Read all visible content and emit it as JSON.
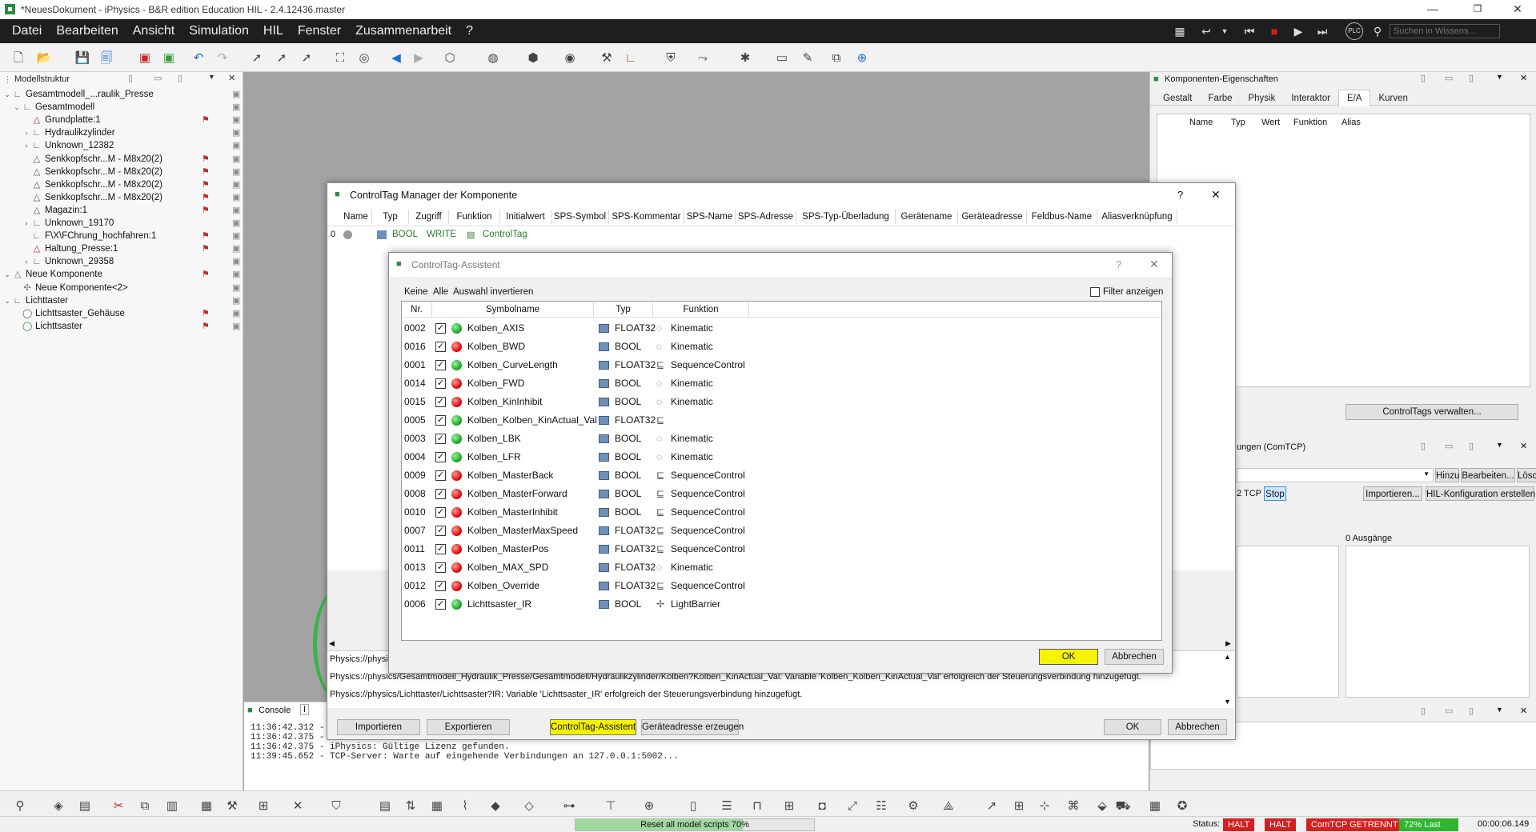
{
  "window": {
    "title": "*NeuesDokument - iPhysics - B&R edition Education HIL - 2.4.12436.master"
  },
  "menu": [
    "Datei",
    "Bearbeiten",
    "Ansicht",
    "Simulation",
    "HIL",
    "Fenster",
    "Zusammenarbeit",
    "?"
  ],
  "search": {
    "placeholder": "Suchen in Wissens..."
  },
  "plc_label": "PLC",
  "left_panel": {
    "title": "Modellstruktur",
    "tree": [
      {
        "label": "Gesamtmodell_...raulik_Presse",
        "level": 0
      },
      {
        "label": "Gesamtmodell",
        "level": 1
      },
      {
        "label": "Grundplatte:1",
        "level": 2
      },
      {
        "label": "Hydraulikzylinder",
        "level": 2
      },
      {
        "label": "Unknown_12382",
        "level": 2
      },
      {
        "label": "Senkkopfschr...M - M8x20(2)",
        "level": 2
      },
      {
        "label": "Senkkopfschr...M - M8x20(2)",
        "level": 2
      },
      {
        "label": "Senkkopfschr...M - M8x20(2)",
        "level": 2
      },
      {
        "label": "Senkkopfschr...M - M8x20(2)",
        "level": 2
      },
      {
        "label": "Magazin:1",
        "level": 2
      },
      {
        "label": "Unknown_19170",
        "level": 2
      },
      {
        "label": "F\\X\\FChrung_hochfahren:1",
        "level": 2
      },
      {
        "label": "Haltung_Presse:1",
        "level": 2
      },
      {
        "label": "Unknown_29358",
        "level": 2
      },
      {
        "label": "Neue Komponente",
        "level": 0
      },
      {
        "label": "Neue Komponente<2>",
        "level": 1
      },
      {
        "label": "Lichttaster",
        "level": 0
      },
      {
        "label": "Lichttsaster_Gehäuse",
        "level": 1
      },
      {
        "label": "Lichttsaster",
        "level": 1
      }
    ]
  },
  "right_panel": {
    "title": "Komponenten-Eigenschaften",
    "tabs": [
      "Gestalt",
      "Farbe",
      "Physik",
      "Interaktor",
      "E/A",
      "Kurven"
    ],
    "columns": [
      "Name",
      "Typ",
      "Wert",
      "Funktion",
      "Alias"
    ],
    "manage_button": "ControlTags verwalten...",
    "conn_title": "ungen (ComTCP)",
    "btn_add": "Hinzu",
    "btn_edit": "Bearbeiten...",
    "btn_del": "Löschen",
    "tcp_label": "2 TCP",
    "btn_stop": "Stop",
    "btn_import": "Importieren...",
    "btn_hil": "HIL-Konfiguration erstellen",
    "outputs_label": "0 Ausgänge"
  },
  "manager": {
    "title": "ControlTag Manager der Komponente",
    "help": "?",
    "close": "✕",
    "columns": [
      "Name",
      "Typ",
      "Zugriff",
      "Funktion",
      "Initialwert",
      "SPS-Symbol",
      "SPS-Kommentar",
      "SPS-Name",
      "SPS-Adresse",
      "SPS-Typ-Überladung",
      "Gerätename",
      "Geräteadresse",
      "Feldbus-Name",
      "Aliasverknüpfung"
    ],
    "row": {
      "index": "0",
      "type": "BOOL",
      "access": "WRITE",
      "function": "ControlTag"
    },
    "log": [
      "Physics://physi",
      "Physics://physics/Gesamtmodell_Hydraulik_Presse/Gesamtmodell/Hydraulikzylinder/Kolben?Kolben_KinActual_Val: Variable 'Kolben_Kolben_KinActual_Val' erfolgreich der Steuerungsverbindung hinzugefügt.",
      "Physics://physics/Lichttaster/Lichttsaster?IR: Variable 'Lichttsaster_IR' erfolgreich der Steuerungsverbindung hinzugefügt."
    ],
    "buttons": {
      "import": "Importieren",
      "export": "Exportieren",
      "assistant": "ControlTag-Assistent",
      "address": "Geräteadresse erzeugen",
      "ok": "OK",
      "cancel": "Abbrechen"
    }
  },
  "assistant": {
    "title": "ControlTag-Assistent",
    "help": "?",
    "close": "✕",
    "links": [
      "Keine",
      "Alle",
      "Auswahl invertieren"
    ],
    "filter_label": "Filter anzeigen",
    "columns": [
      "Nr.",
      "Symbolname",
      "Typ",
      "Funktion"
    ],
    "rows": [
      {
        "nr": "0002",
        "name": "Kolben_AXIS",
        "type": "FLOAT32",
        "func": "Kinematic",
        "status": "green"
      },
      {
        "nr": "0016",
        "name": "Kolben_BWD",
        "type": "BOOL",
        "func": "Kinematic",
        "status": "red"
      },
      {
        "nr": "0001",
        "name": "Kolben_CurveLength",
        "type": "FLOAT32",
        "func": "SequenceControl",
        "status": "green"
      },
      {
        "nr": "0014",
        "name": "Kolben_FWD",
        "type": "BOOL",
        "func": "Kinematic",
        "status": "red"
      },
      {
        "nr": "0015",
        "name": "Kolben_KinInhibit",
        "type": "BOOL",
        "func": "Kinematic",
        "status": "red"
      },
      {
        "nr": "0005",
        "name": "Kolben_Kolben_KinActual_Val",
        "type": "FLOAT32",
        "func": "",
        "status": "green"
      },
      {
        "nr": "0003",
        "name": "Kolben_LBK",
        "type": "BOOL",
        "func": "Kinematic",
        "status": "green"
      },
      {
        "nr": "0004",
        "name": "Kolben_LFR",
        "type": "BOOL",
        "func": "Kinematic",
        "status": "green"
      },
      {
        "nr": "0009",
        "name": "Kolben_MasterBack",
        "type": "BOOL",
        "func": "SequenceControl",
        "status": "red"
      },
      {
        "nr": "0008",
        "name": "Kolben_MasterForward",
        "type": "BOOL",
        "func": "SequenceControl",
        "status": "red"
      },
      {
        "nr": "0010",
        "name": "Kolben_MasterInhibit",
        "type": "BOOL",
        "func": "SequenceControl",
        "status": "red"
      },
      {
        "nr": "0007",
        "name": "Kolben_MasterMaxSpeed",
        "type": "FLOAT32",
        "func": "SequenceControl",
        "status": "red"
      },
      {
        "nr": "0011",
        "name": "Kolben_MasterPos",
        "type": "FLOAT32",
        "func": "SequenceControl",
        "status": "red"
      },
      {
        "nr": "0013",
        "name": "Kolben_MAX_SPD",
        "type": "FLOAT32",
        "func": "Kinematic",
        "status": "red"
      },
      {
        "nr": "0012",
        "name": "Kolben_Override",
        "type": "FLOAT32",
        "func": "SequenceControl",
        "status": "red"
      },
      {
        "nr": "0006",
        "name": "Lichttsaster_IR",
        "type": "BOOL",
        "func": "LightBarrier",
        "status": "green"
      }
    ],
    "ok": "OK",
    "cancel": "Abbrechen"
  },
  "console": {
    "title": "Console",
    "lines": [
      "11:36:42.312 -",
      "11:36:42.375 -",
      "11:36:42.375 - iPhysics: Gültige Lizenz gefunden.",
      "11:39:45.652 - TCP-Server: Warte auf eingehende Verbindungen an 127.0.0.1:5002..."
    ]
  },
  "status": {
    "progress_text": "Reset all model scripts 70%",
    "progress_value": 0.7,
    "label": "Status:",
    "halt1": "HALT",
    "halt2": "HALT",
    "comtcp": "ComTCP GETRENNT",
    "load": "72% Last",
    "time": "00:00:06.149"
  },
  "colors": {
    "highlight": "#f5f300",
    "status_red": "#d42020",
    "status_green": "#2fb52f",
    "menubar": "#1e1e1e"
  }
}
